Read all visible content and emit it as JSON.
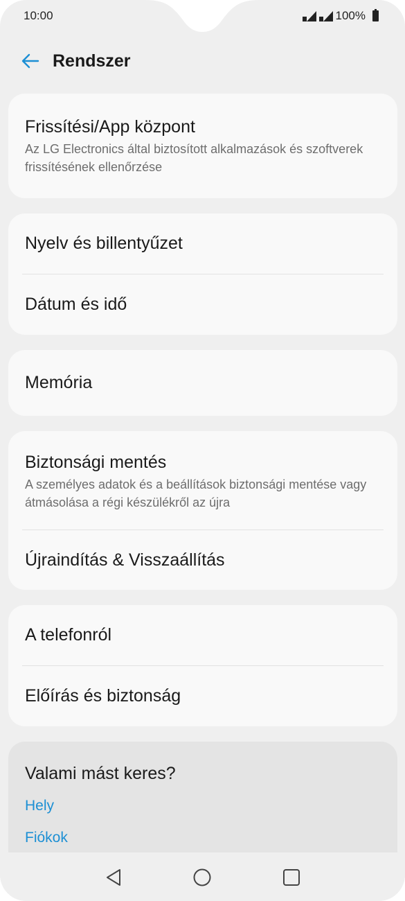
{
  "status": {
    "time": "10:00",
    "battery": "100%"
  },
  "appbar": {
    "title": "Rendszer"
  },
  "cards": [
    {
      "items": [
        {
          "title": "Frissítési/App központ",
          "subtitle": "Az LG Electronics által biztosított alkalmazások és szoftverek frissítésének ellenőrzése"
        }
      ]
    },
    {
      "items": [
        {
          "title": "Nyelv és billentyűzet"
        },
        {
          "title": "Dátum és idő"
        }
      ]
    },
    {
      "items": [
        {
          "title": "Memória"
        }
      ]
    },
    {
      "items": [
        {
          "title": "Biztonsági mentés",
          "subtitle": "A személyes adatok és a beállítások biztonsági mentése vagy átmásolása a régi készülékről az újra"
        },
        {
          "title": "Újraindítás & Visszaállítás"
        }
      ]
    },
    {
      "items": [
        {
          "title": "A telefonról"
        },
        {
          "title": "Előírás és biztonság"
        }
      ]
    }
  ],
  "suggest": {
    "title": "Valami mást keres?",
    "links": [
      "Hely",
      "Fiókok"
    ]
  },
  "colors": {
    "accent": "#1c8fd4",
    "background": "#efefef",
    "card": "#f9f9f9"
  }
}
